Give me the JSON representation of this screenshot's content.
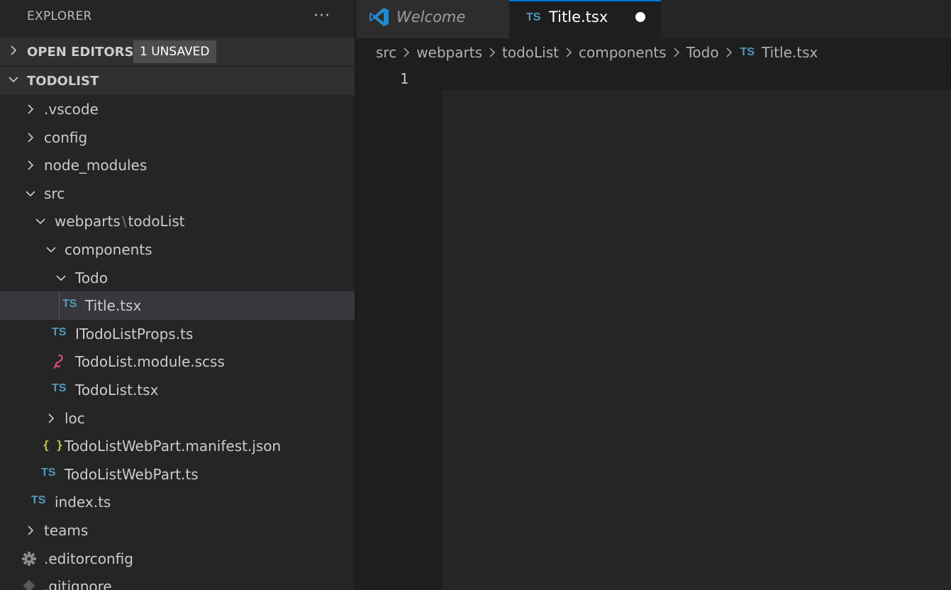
{
  "explorer": {
    "title": "EXPLORER",
    "more": "···"
  },
  "open_editors": {
    "label": "OPEN EDITORS",
    "badge": "1 UNSAVED"
  },
  "workspace": {
    "label": "TODOLIST"
  },
  "tree": {
    "vscode": ".vscode",
    "config": "config",
    "node_modules": "node_modules",
    "src": "src",
    "webparts": "webparts",
    "webparts_sep": "\\",
    "todoList": "todoList",
    "components": "components",
    "todo": "Todo",
    "title_tsx": "Title.tsx",
    "itodolistprops": "ITodoListProps.ts",
    "scss": "TodoList.module.scss",
    "todolist_tsx": "TodoList.tsx",
    "loc": "loc",
    "manifest": "TodoListWebPart.manifest.json",
    "webpart_ts": "TodoListWebPart.ts",
    "index_ts": "index.ts",
    "teams": "teams",
    "editorconfig": ".editorconfig",
    "gitignore": ".gitignore",
    "ts_badge": "TS",
    "json_badge": "{ }"
  },
  "tabs": {
    "welcome": "Welcome",
    "active": "Title.tsx",
    "active_badge": "TS"
  },
  "breadcrumb": {
    "items": [
      "src",
      "webparts",
      "todoList",
      "components",
      "Todo"
    ],
    "file_badge": "TS",
    "file": "Title.tsx"
  },
  "editor": {
    "line_number": "1"
  },
  "colors": {
    "accent": "#0078d4",
    "ts_blue": "#519aba",
    "json_yellow": "#cbcb41",
    "scss_pink": "#f55385"
  }
}
